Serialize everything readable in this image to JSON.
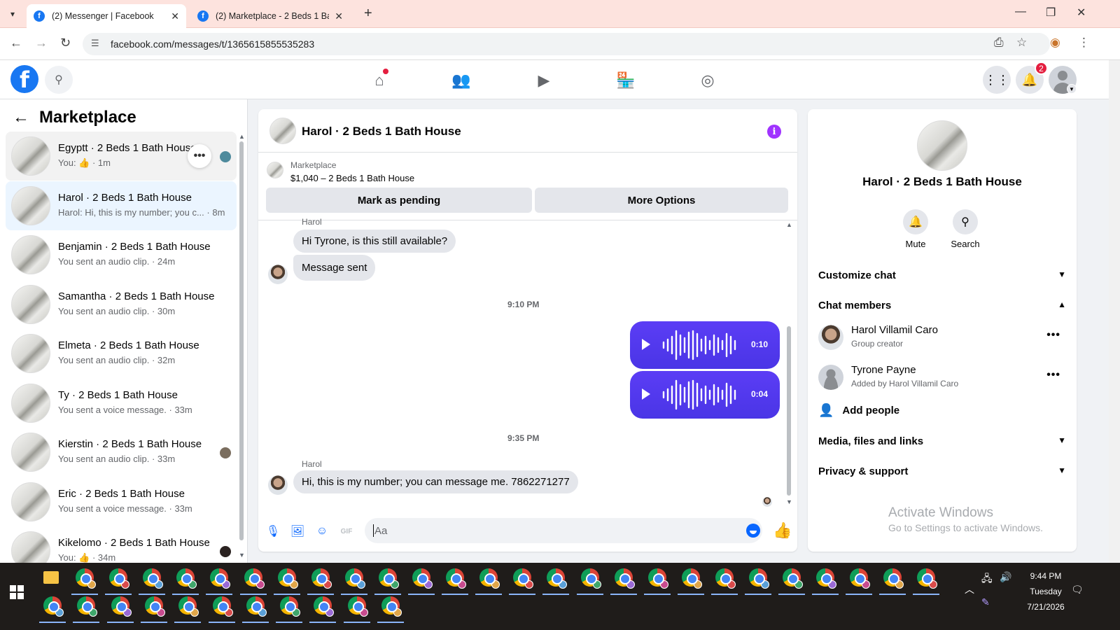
{
  "browser": {
    "tabs": [
      {
        "title": "(2) Messenger | Facebook"
      },
      {
        "title": "(2) Marketplace - 2 Beds 1 Bath"
      }
    ],
    "url": "facebook.com/messages/t/1365615855535283"
  },
  "fb_header": {
    "notification_count": "2"
  },
  "sidebar": {
    "title": "Marketplace",
    "conversations": [
      {
        "name": "Egyptt · 2 Beds 1 Bath House",
        "preview": "You: 👍 · 1m"
      },
      {
        "name": "Harol · 2 Beds 1 Bath House",
        "preview": "Harol: Hi, this is my number; you c... · 8m"
      },
      {
        "name": "Benjamin · 2 Beds 1 Bath House",
        "preview": "You sent an audio clip. · 24m"
      },
      {
        "name": "Samantha · 2 Beds 1 Bath House",
        "preview": "You sent an audio clip. · 30m"
      },
      {
        "name": "Elmeta · 2 Beds 1 Bath House",
        "preview": "You sent an audio clip. · 32m"
      },
      {
        "name": "Ty · 2 Beds 1 Bath House",
        "preview": "You sent a voice message. · 33m"
      },
      {
        "name": "Kierstin · 2 Beds 1 Bath House",
        "preview": "You sent an audio clip. · 33m"
      },
      {
        "name": "Eric · 2 Beds 1 Bath House",
        "preview": "You sent a voice message. · 33m"
      },
      {
        "name": "Kikelomo · 2 Beds 1 Bath House",
        "preview": "You: 👍 · 34m"
      }
    ]
  },
  "chat": {
    "title": "Harol · 2 Beds 1 Bath House",
    "marketplace_label": "Marketplace",
    "listing": "$1,040 – 2 Beds 1 Bath House",
    "mark_pending": "Mark as pending",
    "more_options": "More Options",
    "messages": {
      "sender_top": "Harol",
      "m1": "Hi Tyrone, is this still available?",
      "m2": "Message sent",
      "time1": "9:10 PM",
      "audio1_duration": "0:10",
      "audio2_duration": "0:04",
      "time2": "9:35 PM",
      "sender_bottom": "Harol",
      "m3": "Hi, this is my number; you can message me. 7862271277"
    },
    "composer_placeholder": "Aa"
  },
  "info_panel": {
    "name": "Harol · 2 Beds 1 Bath House",
    "mute": "Mute",
    "search": "Search",
    "customize_chat": "Customize chat",
    "chat_members": "Chat members",
    "members": [
      {
        "name": "Harol Villamil Caro",
        "role": "Group creator"
      },
      {
        "name": "Tyrone Payne",
        "role": "Added by Harol Villamil Caro"
      }
    ],
    "add_people": "Add people",
    "media": "Media, files and links",
    "privacy": "Privacy & support"
  },
  "watermark": {
    "line1": "Activate Windows",
    "line2": "Go to Settings to activate Windows."
  },
  "taskbar": {
    "time": "9:44 PM",
    "day": "Tuesday",
    "date": "7/21/2026"
  },
  "colors": {
    "fb_blue": "#1877f2",
    "messenger_blue": "#0866ff",
    "audio_bubble": "#4c36e8",
    "tab_strip": "#fde3de"
  }
}
